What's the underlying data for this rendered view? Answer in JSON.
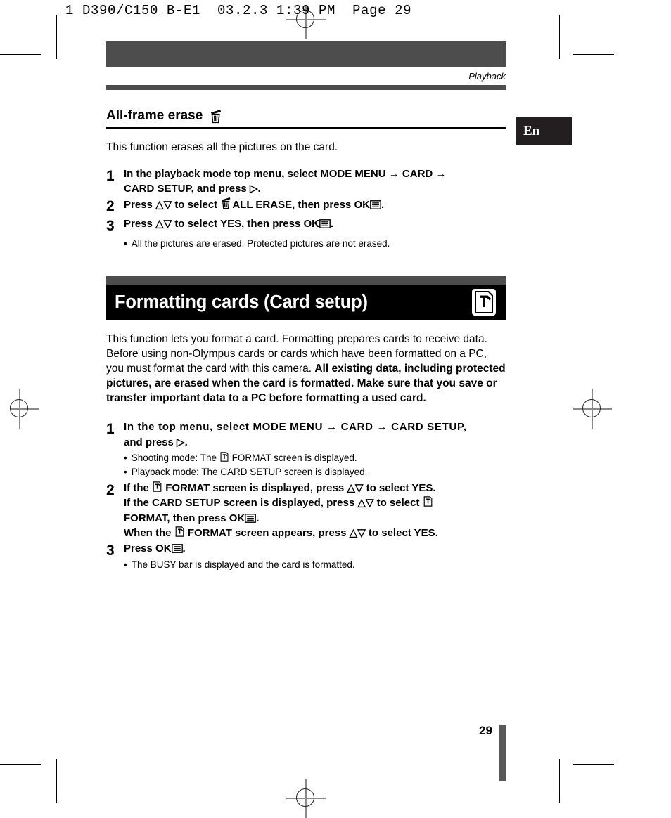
{
  "prepress": {
    "header_line": "1 D390/C150_B-E1  03.2.3 1:39 PM  Page 29"
  },
  "running_head": "Playback",
  "language_tab": "En",
  "page_number": "29",
  "section_erase": {
    "heading": "All-frame erase",
    "heading_icon": "trash-icon",
    "intro": "This function erases all the pictures on the card.",
    "steps": [
      {
        "num": "1",
        "line1_a": "In the playback mode top menu, select MODE MENU",
        "line1_arrow1": "→",
        "line1_b": "CARD",
        "line1_arrow2": "→",
        "line2_a": "CARD SETUP, and press",
        "line2_tri": "▷",
        "line2_b": "."
      },
      {
        "num": "2",
        "a": "Press",
        "tri_up": "△",
        "tri_down": "▽",
        "b": "to select",
        "icon": "trash-icon",
        "c": "ALL ERASE, then press",
        "ok": "OK",
        "d": "."
      },
      {
        "num": "3",
        "a": "Press",
        "tri_up": "△",
        "tri_down": "▽",
        "b": "to select YES, then press",
        "ok": "OK",
        "d": "."
      }
    ],
    "bullet": "All the pictures are erased. Protected pictures are not erased."
  },
  "section_format": {
    "banner_title": "Formatting cards (Card setup)",
    "banner_icon": "card-format-icon",
    "para_normal": "This function lets you format a card. Formatting prepares cards to receive data. Before using non-Olympus cards or cards which have been formatted on a PC, you must format the card with this camera.",
    "para_bold": "All existing data, including protected pictures, are erased when the card is formatted. Make sure that you save or transfer important data to a PC before formatting a used card.",
    "steps": [
      {
        "num": "1",
        "line1_a": "In the top menu, select MODE MENU",
        "line1_arrow1": "→",
        "line1_b": "CARD",
        "line1_arrow2": "→",
        "line1_c": "CARD SETUP,",
        "line2_a": "and press",
        "line2_tri": "▷",
        "line2_b": ".",
        "bullets": [
          {
            "a": "Shooting mode: The",
            "icon": "card-format-icon",
            "b": "FORMAT screen is displayed."
          },
          {
            "a": "Playback mode: The CARD SETUP screen is displayed.",
            "icon": "",
            "b": ""
          }
        ]
      },
      {
        "num": "2",
        "l1_a": "If the",
        "l1_icon": "card-format-icon",
        "l1_b": "FORMAT screen is displayed, press",
        "l1_tri_up": "△",
        "l1_tri_down": "▽",
        "l1_c": "to select YES.",
        "l2_a": "If the CARD SETUP screen is displayed, press",
        "l2_tri_up": "△",
        "l2_tri_down": "▽",
        "l2_b": "to select",
        "l2_icon": "card-format-icon",
        "l3_a": "FORMAT, then press",
        "l3_ok": "OK",
        "l3_b": ".",
        "l4_a": "When the",
        "l4_icon": "card-format-icon",
        "l4_b": "FORMAT screen appears, press",
        "l4_tri_up": "△",
        "l4_tri_down": "▽",
        "l4_c": "to select YES."
      },
      {
        "num": "3",
        "a": "Press",
        "ok": "OK",
        "b": ".",
        "bullets": [
          {
            "a": "The BUSY bar is displayed and the card is formatted.",
            "icon": "",
            "b": ""
          }
        ]
      }
    ]
  },
  "colors": {
    "gray_bar": "#4d4d4d",
    "banner_black": "#000000",
    "tab_black": "#231f20",
    "page_bar": "#595959"
  }
}
